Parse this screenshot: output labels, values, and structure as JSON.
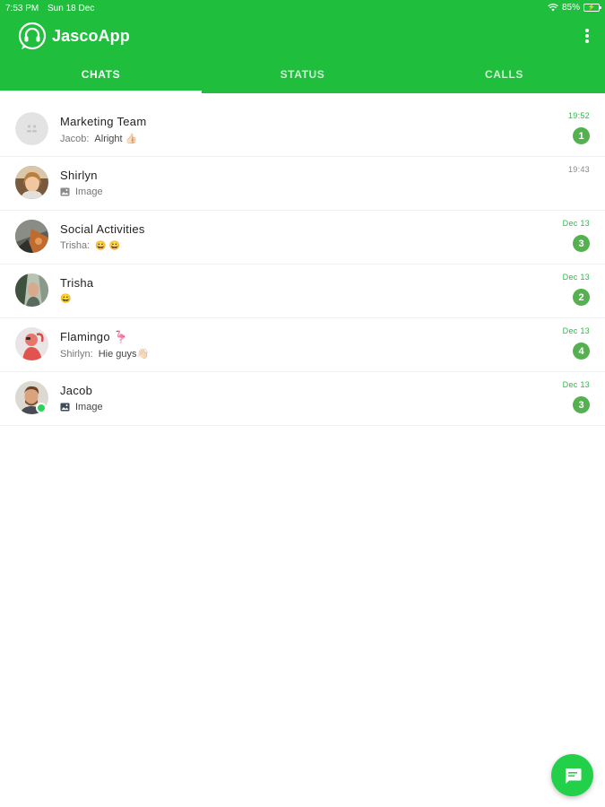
{
  "statusbar": {
    "time": "7:53 PM",
    "date": "Sun 18 Dec",
    "battery": "85%"
  },
  "header": {
    "title": "JascoApp"
  },
  "tabs": [
    {
      "label": "CHATS",
      "active": true
    },
    {
      "label": "STATUS",
      "active": false
    },
    {
      "label": "CALLS",
      "active": false
    }
  ],
  "chats": [
    {
      "name": "Marketing Team",
      "sender": "Jacob:",
      "message": "Alright 👍🏻",
      "time": "19:52",
      "unread": "1",
      "avatar": "group-placeholder"
    },
    {
      "name": "Shirlyn",
      "sender": "",
      "message": "Image",
      "time": "19:43",
      "unread": "",
      "avatar": "photo"
    },
    {
      "name": "Social Activities",
      "sender": "Trisha:",
      "message": "😀 😀",
      "time": "Dec 13",
      "unread": "3",
      "avatar": "photo"
    },
    {
      "name": "Trisha",
      "sender": "",
      "message": "😀",
      "time": "Dec 13",
      "unread": "2",
      "avatar": "photo"
    },
    {
      "name": "Flamingo 🦩",
      "sender": "Shirlyn:",
      "message": "Hie guys👋🏻",
      "time": "Dec 13",
      "unread": "4",
      "avatar": "photo"
    },
    {
      "name": "Jacob",
      "sender": "",
      "message": "Image",
      "time": "Dec 13",
      "unread": "3",
      "avatar": "photo",
      "online": true
    }
  ],
  "colors": {
    "primary": "#1fbe3d",
    "badge": "#55b14f",
    "fab": "#22d04a",
    "time_unread": "#2fb84a"
  }
}
